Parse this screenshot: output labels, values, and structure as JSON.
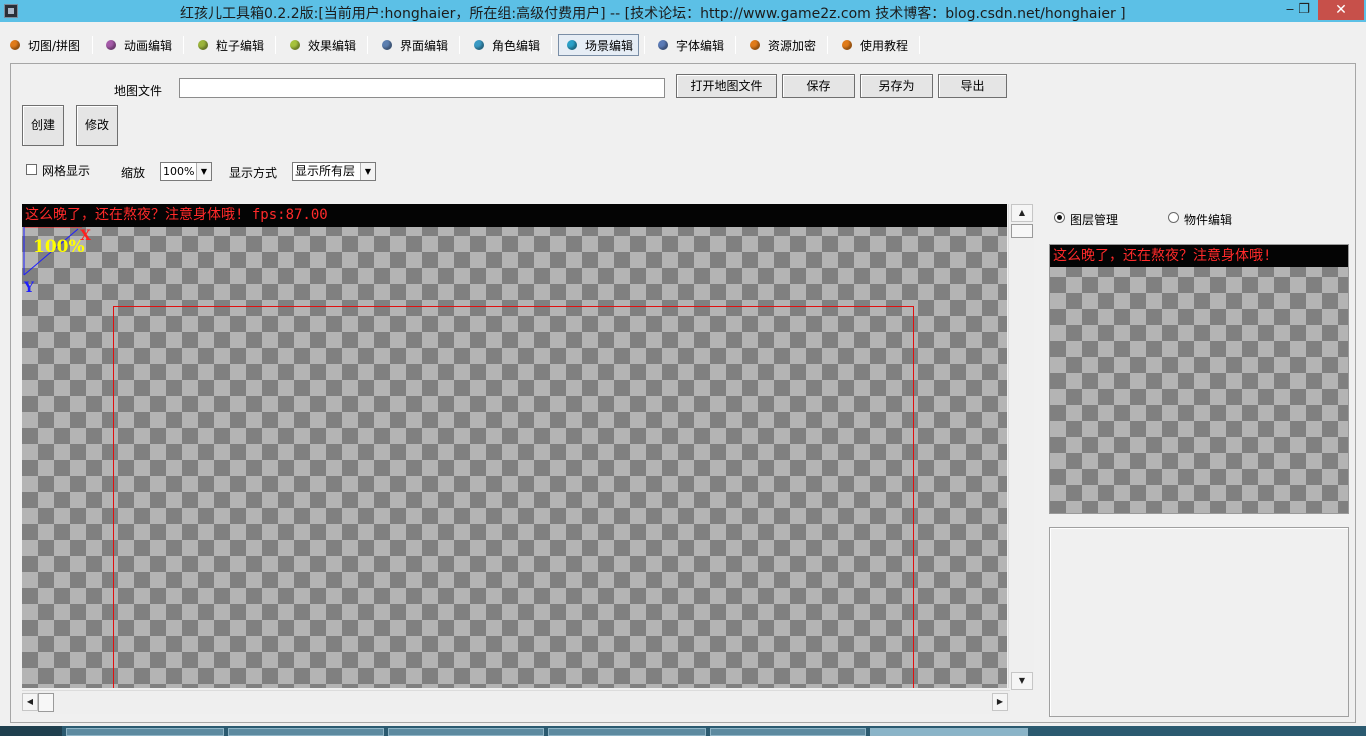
{
  "window": {
    "title": "红孩儿工具箱0.2.2版:[当前用户:honghaier，所在组:高级付费用户]  --  [技术论坛：http://www.game2z.com 技术博客：blog.csdn.net/honghaier ]",
    "minimize_glyph": "‒",
    "restore_glyph": "❐",
    "close_glyph": "✕"
  },
  "toolbar": {
    "tabs": [
      {
        "label": "切图/拼图",
        "color": "#e07b1a"
      },
      {
        "label": "动画编辑",
        "color": "#a45aa8"
      },
      {
        "label": "粒子编辑",
        "color": "#9bb43a"
      },
      {
        "label": "效果编辑",
        "color": "#a6c23c"
      },
      {
        "label": "界面编辑",
        "color": "#5c7fb0"
      },
      {
        "label": "角色编辑",
        "color": "#3a9ac4"
      },
      {
        "label": "场景编辑",
        "color": "#2aa0c8"
      },
      {
        "label": "字体编辑",
        "color": "#5a7ab6"
      },
      {
        "label": "资源加密",
        "color": "#e07b1a"
      },
      {
        "label": "使用教程",
        "color": "#e07b1a"
      }
    ],
    "active_tab": "场景编辑"
  },
  "scene": {
    "map_file_label": "地图文件",
    "map_file_value": "",
    "open_map_button": "打开地图文件",
    "save_button": "保存",
    "save_as_button": "另存为",
    "export_button": "导出",
    "create_button": "创建",
    "modify_button": "修改",
    "grid_label": "网格显示",
    "grid_checked": false,
    "zoom_label": "缩放",
    "zoom_value": "100%",
    "display_mode_label": "显示方式",
    "display_mode_value": "显示所有层"
  },
  "canvas": {
    "banner": "这么晚了，还在熬夜？注意身体哦! fps:87.00",
    "zoom_indicator": "100%",
    "axis_x": "X",
    "axis_y": "Y",
    "banner_color": "#ff2a2a",
    "bounds_color": "#e01010"
  },
  "right_panel": {
    "mode_layer": "图层管理",
    "mode_object": "物件编辑",
    "selected_mode": "图层管理",
    "preview_banner": "这么晚了，还在熬夜？注意身体哦!"
  },
  "colors": {
    "titlebar": "#5cc0e6",
    "close_button": "#c7504a",
    "checker_dark": "#808080",
    "checker_light": "#b4b4b4"
  }
}
